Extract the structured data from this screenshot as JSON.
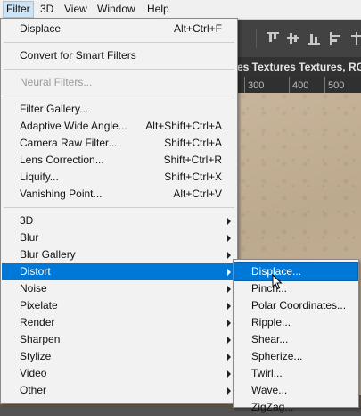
{
  "menubar": {
    "items": [
      {
        "label": "Filter",
        "active": true
      },
      {
        "label": "3D"
      },
      {
        "label": "View"
      },
      {
        "label": "Window"
      },
      {
        "label": "Help"
      }
    ]
  },
  "document": {
    "tab_title": "es Textures Textures, RGB/"
  },
  "ruler": {
    "ticks": [
      "300",
      "400",
      "500"
    ]
  },
  "filter_menu": {
    "last_filter": {
      "label": "Displace",
      "shortcut": "Alt+Ctrl+F"
    },
    "convert": {
      "label": "Convert for Smart Filters"
    },
    "neural": {
      "label": "Neural Filters...",
      "disabled": true
    },
    "gallery": {
      "label": "Filter Gallery..."
    },
    "adaptive": {
      "label": "Adaptive Wide Angle...",
      "shortcut": "Alt+Shift+Ctrl+A"
    },
    "camera_raw": {
      "label": "Camera Raw Filter...",
      "shortcut": "Shift+Ctrl+A"
    },
    "lens": {
      "label": "Lens Correction...",
      "shortcut": "Shift+Ctrl+R"
    },
    "liquify": {
      "label": "Liquify...",
      "shortcut": "Shift+Ctrl+X"
    },
    "vanishing": {
      "label": "Vanishing Point...",
      "shortcut": "Alt+Ctrl+V"
    },
    "groups": [
      {
        "label": "3D"
      },
      {
        "label": "Blur"
      },
      {
        "label": "Blur Gallery"
      },
      {
        "label": "Distort",
        "highlighted": true
      },
      {
        "label": "Noise"
      },
      {
        "label": "Pixelate"
      },
      {
        "label": "Render"
      },
      {
        "label": "Sharpen"
      },
      {
        "label": "Stylize"
      },
      {
        "label": "Video"
      },
      {
        "label": "Other"
      }
    ]
  },
  "distort_submenu": {
    "items": [
      {
        "label": "Displace...",
        "highlighted": true
      },
      {
        "label": "Pinch..."
      },
      {
        "label": "Polar Coordinates..."
      },
      {
        "label": "Ripple..."
      },
      {
        "label": "Shear..."
      },
      {
        "label": "Spherize..."
      },
      {
        "label": "Twirl..."
      },
      {
        "label": "Wave..."
      },
      {
        "label": "ZigZag..."
      }
    ]
  },
  "colors": {
    "highlight": "#0078d7",
    "menu_bg": "#f2f2f2"
  }
}
